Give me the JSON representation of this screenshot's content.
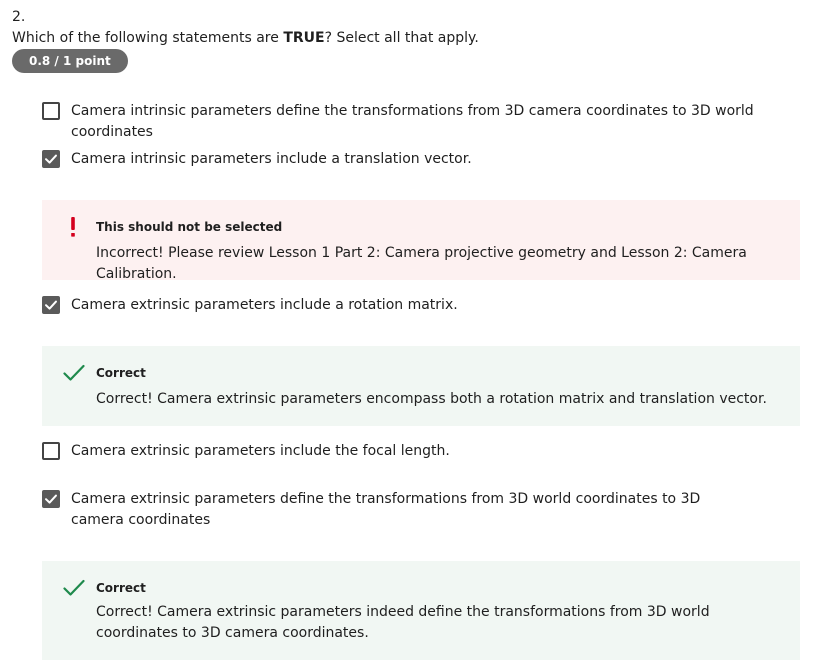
{
  "question": {
    "number": "2.",
    "prompt_before": "Which of the following statements are ",
    "prompt_bold": "TRUE",
    "prompt_after": "? Select all that apply.",
    "score": "0.8 / 1 point"
  },
  "options": [
    {
      "label": "Camera intrinsic parameters define the transformations from 3D camera coordinates to 3D world coordinates",
      "checked": false
    },
    {
      "label": "Camera intrinsic parameters include a translation vector.",
      "checked": true
    },
    {
      "label": "Camera extrinsic parameters include a rotation matrix.",
      "checked": true
    },
    {
      "label": "Camera extrinsic parameters include the focal length.",
      "checked": false
    },
    {
      "label": "Camera extrinsic parameters define the transformations from 3D world coordinates to 3D camera coordinates",
      "checked": true
    }
  ],
  "feedback": [
    {
      "type": "incorrect",
      "icon": "exclamation-icon",
      "title": "This should not be selected",
      "text": "Incorrect! Please review Lesson 1 Part 2: Camera projective geometry and Lesson 2: Camera Calibration."
    },
    {
      "type": "correct",
      "icon": "checkmark-icon",
      "title": "Correct",
      "text": "Correct! Camera extrinsic parameters encompass both a rotation matrix and translation vector."
    },
    {
      "type": "correct",
      "icon": "checkmark-icon",
      "title": "Correct",
      "text": "Correct! Camera extrinsic parameters indeed define the transformations from 3D world coordinates to 3D camera coordinates."
    }
  ],
  "colors": {
    "incorrect_bg": "#fdf1f1",
    "incorrect_icon": "#d4001e",
    "correct_bg": "#f1f7f3",
    "correct_icon": "#1f8a4c",
    "checkbox_checked": "#5a5a5a",
    "score_badge": "#6a6a6a"
  }
}
